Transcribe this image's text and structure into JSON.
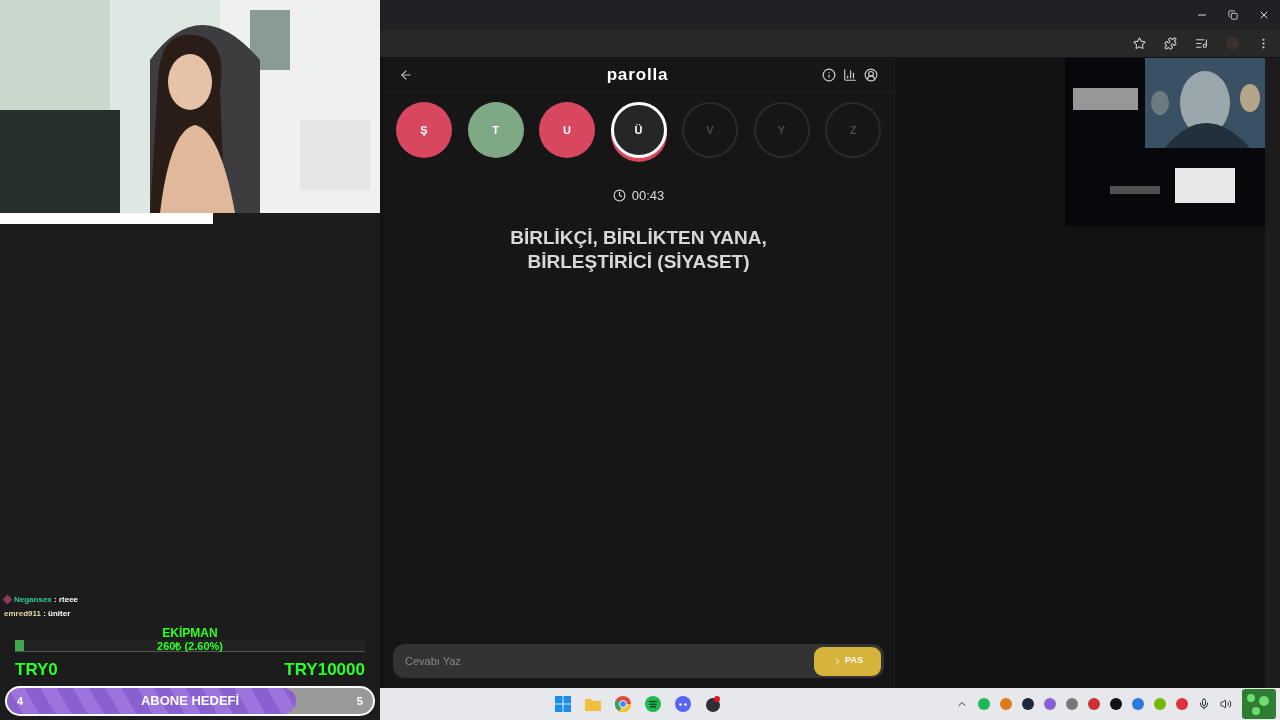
{
  "overlay": {
    "chat": [
      {
        "user": "Negansex",
        "text": ": rteee",
        "color": "#2ecc9a",
        "badge": true
      },
      {
        "user": "emred911",
        "text": ": üniter",
        "color": "#e8d9a8",
        "badge": false
      }
    ],
    "goal": {
      "title": "EKİPMAN",
      "amount": "260₺ (2.60%)",
      "level": 0.026,
      "min": "TRY0",
      "max": "TRY10000"
    },
    "sub_goal": {
      "start": "4",
      "label": "ABONE HEDEFİ",
      "end": "5",
      "level": 0.79
    }
  },
  "game": {
    "title": "parolla",
    "letters": [
      {
        "letter": "Ş",
        "kind": "wrong"
      },
      {
        "letter": "T",
        "kind": "correct"
      },
      {
        "letter": "U",
        "kind": "wrong"
      },
      {
        "letter": "Ü",
        "kind": "current"
      },
      {
        "letter": "V",
        "kind": "pending"
      },
      {
        "letter": "Y",
        "kind": "pending"
      },
      {
        "letter": "Z",
        "kind": "pending"
      }
    ],
    "timer": "00:43",
    "clue": "BİRLİKÇİ, BİRLİKTEN YANA, BİRLEŞTİRİCİ (SİYASET)",
    "answer": {
      "placeholder": "Cevabı Yaz"
    },
    "pass_button": "PAS"
  }
}
